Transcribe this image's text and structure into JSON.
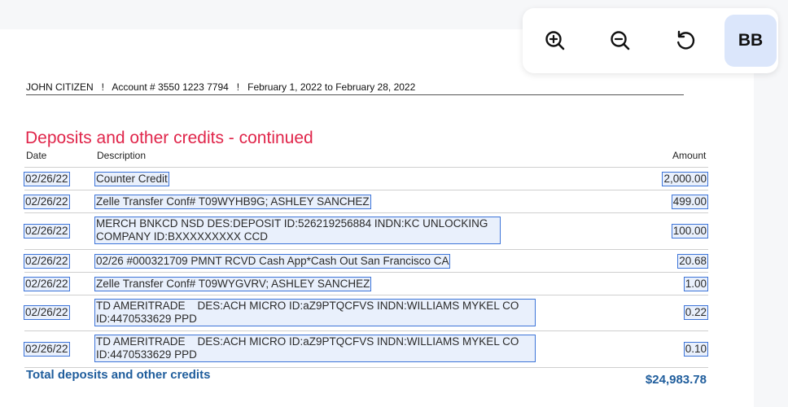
{
  "toolbar": {
    "zoom_in_icon": "zoom-in-icon",
    "zoom_out_icon": "zoom-out-icon",
    "rotate_icon": "rotate-icon",
    "avatar_initials": "BB"
  },
  "statement": {
    "header": "JOHN CITIZEN   !   Account # 3550 1223 7794   !   February 1, 2022 to February 28, 2022",
    "section_title": "Deposits and other credits - continued",
    "columns": {
      "date": "Date",
      "description": "Description",
      "amount": "Amount"
    },
    "rows": [
      {
        "date": "02/26/22",
        "description": "Counter Credit",
        "amount": "2,000.00"
      },
      {
        "date": "02/26/22",
        "description": "Zelle Transfer Conf# T09WYHB9G; ASHLEY SANCHEZ",
        "amount": "499.00"
      },
      {
        "date": "02/26/22",
        "description_line1": "MERCH BNKCD NSD DES:DEPOSIT ID:526219256884 INDN:KC UNLOCKING",
        "description_line2": "COMPANY ID:BXXXXXXXXX CCD",
        "amount": "100.00"
      },
      {
        "date": "02/26/22",
        "description": "02/26 #000321709 PMNT RCVD Cash App*Cash Out San Francisco CA",
        "amount": "20.68"
      },
      {
        "date": "02/26/22",
        "description": "Zelle Transfer Conf# T09WYGVRV; ASHLEY SANCHEZ",
        "amount": "1.00"
      },
      {
        "date": "02/26/22",
        "description_line1": "TD AMERITRADE    DES:ACH MICRO ID:aZ9PTQCFVS INDN:WILLIAMS MYKEL CO",
        "description_line2": "ID:4470533629 PPD",
        "amount": "0.22"
      },
      {
        "date": "02/26/22",
        "description_line1": "TD AMERITRADE    DES:ACH MICRO ID:aZ9PTQCFVS INDN:WILLIAMS MYKEL CO",
        "description_line2": "ID:4470533629 PPD",
        "amount": "0.10"
      }
    ],
    "total_label": "Total deposits and other credits",
    "total_value": "$24,983.78"
  }
}
